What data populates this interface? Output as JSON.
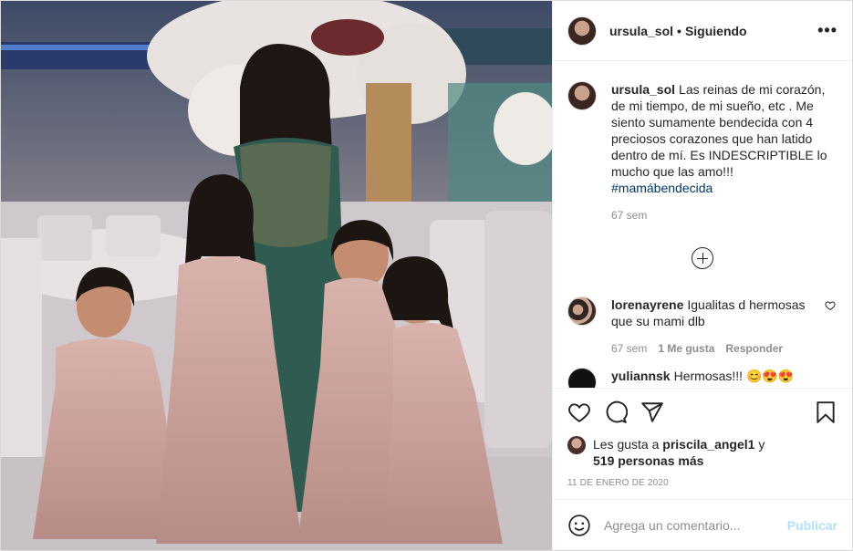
{
  "header": {
    "username": "ursula_sol",
    "separator": "•",
    "follow_state": "Siguiendo",
    "more": "•••"
  },
  "caption": {
    "username": "ursula_sol",
    "text": "Las reinas de mi corazón, de mi tiempo, de mi sueño, etc . Me siento sumamente bendecida con 4 preciosos corazones que han latido dentro de mí. Es INDESCRIPTIBLE lo mucho que las amo!!!",
    "hashtag": "#mamábendecida",
    "time": "67 sem"
  },
  "comments": [
    {
      "username": "lorenayrene",
      "text": "Igualitas d hermosas que su mami dlb",
      "time": "67 sem",
      "likes": "1 Me gusta",
      "reply": "Responder"
    },
    {
      "username": "yuliannsk",
      "text": "Hermosas!!! 😊😍😍"
    }
  ],
  "likes": {
    "prefix": "Les gusta a",
    "user": "priscila_angel1",
    "conj": "y",
    "count": "519 personas más"
  },
  "date": "11 DE ENERO DE 2020",
  "add_comment": {
    "placeholder": "Agrega un comentario...",
    "publish": "Publicar"
  },
  "icons": {
    "like": "heart-icon",
    "comment": "comment-icon",
    "share": "share-icon",
    "save": "bookmark-icon",
    "emoji": "emoji-icon",
    "load_more": "plus-circle-icon"
  }
}
